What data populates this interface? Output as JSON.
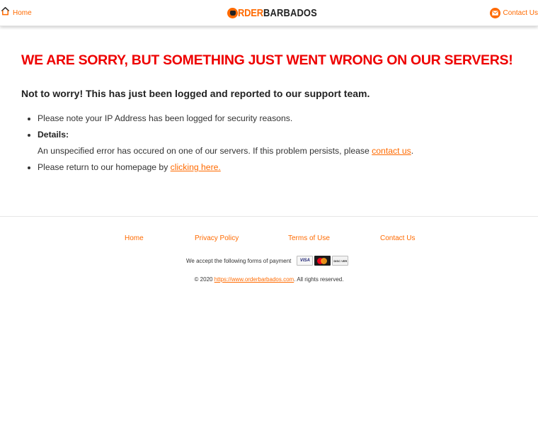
{
  "header": {
    "home_label": "Home",
    "logo_word1": "RDER",
    "logo_word2": "BARBADOS",
    "contact_label": "Contact Us"
  },
  "main": {
    "error_heading": "WE ARE SORRY, BUT SOMETHING JUST WENT WRONG ON OUR SERVERS!",
    "subheading": "Not to worry! This has just been logged and reported to our support team.",
    "items": {
      "ip_note": "Please note your IP Address has been logged for security reasons.",
      "details_title": "Details:",
      "details_text": "An unspecified error has occured on one of our servers. If this problem persists, please ",
      "details_link": "contact us",
      "details_after": ".",
      "return_text": "Please return to our homepage by ",
      "return_link": "clicking here."
    }
  },
  "footer": {
    "links": {
      "home": "Home",
      "privacy": "Privacy Policy",
      "terms": "Terms of Use",
      "contact": "Contact Us"
    },
    "payment_text": "We accept the following forms of payment",
    "cards": {
      "visa": "VISA",
      "discover": "DISC VER"
    },
    "copyright_prefix": "© 2020 ",
    "copyright_link": "https://www.orderbarbados.com",
    "copyright_suffix": ". All rights reserved."
  },
  "colors": {
    "accent": "#ff6a00",
    "error": "#ee0000",
    "text": "#222222"
  }
}
